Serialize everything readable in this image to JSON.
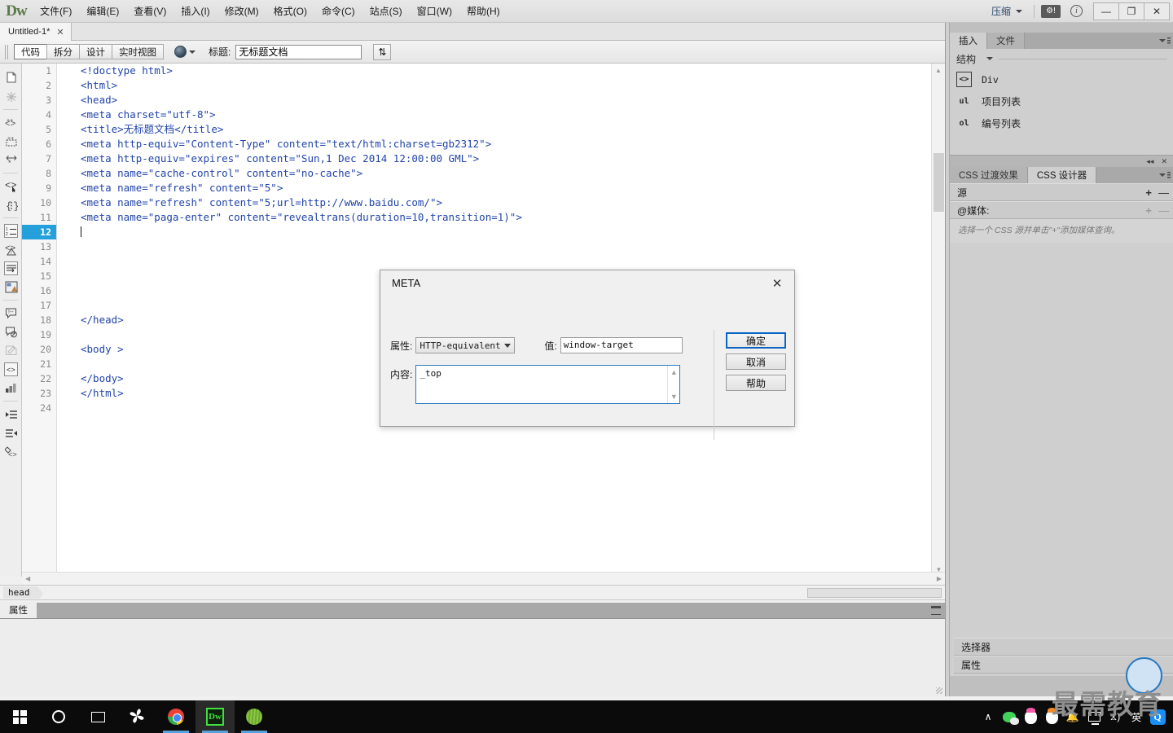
{
  "app": {
    "logo": "Dw",
    "menus": [
      {
        "label": "文件(F)"
      },
      {
        "label": "编辑(E)"
      },
      {
        "label": "查看(V)"
      },
      {
        "label": "插入(I)"
      },
      {
        "label": "修改(M)"
      },
      {
        "label": "格式(O)"
      },
      {
        "label": "命令(C)"
      },
      {
        "label": "站点(S)"
      },
      {
        "label": "窗口(W)"
      },
      {
        "label": "帮助(H)"
      }
    ],
    "workspace_label": "压缩",
    "bug_icon": "bug-report-icon",
    "info_icon": "info-icon",
    "window_buttons": {
      "minimize": "—",
      "restore": "❐",
      "close": "✕"
    }
  },
  "document_tab": {
    "title": "Untitled-1*",
    "close": "✕"
  },
  "viewbar": {
    "buttons": [
      {
        "label": "代码",
        "active": true
      },
      {
        "label": "拆分",
        "active": false
      },
      {
        "label": "设计",
        "active": false
      },
      {
        "label": "实时视图",
        "active": false
      }
    ],
    "title_label": "标题:",
    "title_value": "无标题文档",
    "file_management_icon": "globe-icon",
    "updown_icon": "upload-download-icon"
  },
  "code": {
    "lines": [
      {
        "n": "1",
        "text": "<!doctype html>"
      },
      {
        "n": "2",
        "text": "<html>"
      },
      {
        "n": "3",
        "text": "<head>"
      },
      {
        "n": "4",
        "text": "<meta charset=\"utf-8\">"
      },
      {
        "n": "5",
        "text": "<title>无标题文档</title>"
      },
      {
        "n": "6",
        "text": "<meta http-equiv=\"Content-Type\" content=\"text/html:charset=gb2312\">"
      },
      {
        "n": "7",
        "text": "<meta http-equiv=\"expires\" content=\"Sun,1 Dec 2014 12:00:00 GML\">"
      },
      {
        "n": "8",
        "text": "<meta name=\"cache-control\" content=\"no-cache\">"
      },
      {
        "n": "9",
        "text": "<meta name=\"refresh\" content=\"5\">"
      },
      {
        "n": "10",
        "text": "<meta name=\"refresh\" content=\"5;url=http://www.baidu.com/\">"
      },
      {
        "n": "11",
        "text": "<meta name=\"paga-enter\" content=\"revealtrans(duration=10,transition=1)\">"
      },
      {
        "n": "12",
        "text": "",
        "current": true,
        "caret": true
      },
      {
        "n": "13",
        "text": ""
      },
      {
        "n": "14",
        "text": ""
      },
      {
        "n": "15",
        "text": ""
      },
      {
        "n": "16",
        "text": ""
      },
      {
        "n": "17",
        "text": ""
      },
      {
        "n": "18",
        "text": "</head>"
      },
      {
        "n": "19",
        "text": ""
      },
      {
        "n": "20",
        "text": "<body >"
      },
      {
        "n": "21",
        "text": ""
      },
      {
        "n": "22",
        "text": "</body>"
      },
      {
        "n": "23",
        "text": "</html>"
      },
      {
        "n": "24",
        "text": ""
      }
    ]
  },
  "coding_toolbar": {
    "icons": [
      "open-documents-icon",
      "highlight-invalid-icon",
      "apply-comment-icon",
      "remove-comment-icon",
      "wrap-tag-icon",
      "recent-snippets-icon",
      "collapse-selection-icon",
      "line-numbers-icon",
      "highlight-invalid-code-icon",
      "word-wrap-icon",
      "syntax-color-icon",
      "indent-code-icon",
      "outdent-code-icon",
      "format-source-icon",
      "select-parent-tag-icon",
      "balance-braces-icon",
      "expand-all-icon",
      "collapse-full-tag-icon"
    ]
  },
  "status": {
    "tag_selector": "head",
    "properties_label": "属性"
  },
  "dock": {
    "top_tabs": [
      {
        "label": "插入",
        "active": true
      },
      {
        "label": "文件",
        "active": false
      }
    ],
    "insert": {
      "category": "结构",
      "items": [
        {
          "icon": "div-icon",
          "icon_text": "<>",
          "label": "Div",
          "mono": true
        },
        {
          "icon": "ul-icon",
          "icon_text": "ul",
          "label": "项目列表",
          "mono": false
        },
        {
          "icon": "ol-icon",
          "icon_text": "ol",
          "label": "编号列表",
          "mono": false
        }
      ]
    },
    "collapse_bar": {
      "collapse_icon": "◂◂",
      "close_icon": "✕"
    },
    "css_tabs": [
      {
        "label": "CSS 过渡效果",
        "active": false
      },
      {
        "label": "CSS 设计器",
        "active": true
      }
    ],
    "css_designer": {
      "sources_label": "源",
      "media_label": "@媒体:",
      "hint": "选择一个 CSS 源并单击\"+\"添加媒体查询。",
      "selector_label": "选择器",
      "attrs_label": "属性",
      "add_icon": "+",
      "remove_icon": "—"
    }
  },
  "dialog": {
    "title": "META",
    "close_icon": "✕",
    "attribute_label": "属性:",
    "attribute_value": "HTTP-equivalent",
    "value_label": "值:",
    "value_value": "window-target",
    "content_label": "内容:",
    "content_value": "_top",
    "buttons": [
      {
        "label": "确定",
        "primary": true
      },
      {
        "label": "取消",
        "primary": false
      },
      {
        "label": "帮助",
        "primary": false
      }
    ]
  },
  "taskbar": {
    "items": [
      {
        "name": "start-button",
        "icon": "windows-logo-icon"
      },
      {
        "name": "cortana-search",
        "icon": "cortana-circle-icon"
      },
      {
        "name": "task-view",
        "icon": "task-view-icon"
      },
      {
        "name": "pinwheel-app",
        "icon": "pinwheel-icon"
      },
      {
        "name": "chrome-app",
        "icon": "chrome-icon",
        "running": true
      },
      {
        "name": "dreamweaver-app",
        "icon": "dreamweaver-icon",
        "running": true,
        "active": true
      },
      {
        "name": "green-app",
        "icon": "green-ball-icon",
        "running": true
      }
    ],
    "tray": [
      {
        "name": "show-hidden-icons",
        "icon": "chevron-up-icon",
        "glyph": "∧"
      },
      {
        "name": "wechat-tray",
        "icon": "wechat-icon"
      },
      {
        "name": "qq-tray-1",
        "icon": "qq-penguin-pink-icon"
      },
      {
        "name": "qq-tray-2",
        "icon": "qq-penguin-orange-icon"
      },
      {
        "name": "notifications",
        "icon": "bell-icon",
        "glyph": "🔔"
      },
      {
        "name": "network",
        "icon": "monitor-icon"
      },
      {
        "name": "volume",
        "icon": "speaker-icon",
        "glyph": "⧖)"
      },
      {
        "name": "ime-language",
        "icon": "ime-icon",
        "glyph": "英"
      },
      {
        "name": "qq-browser",
        "icon": "q-logo-icon",
        "glyph": "Q"
      }
    ]
  },
  "watermark": {
    "text": "最需教育"
  }
}
